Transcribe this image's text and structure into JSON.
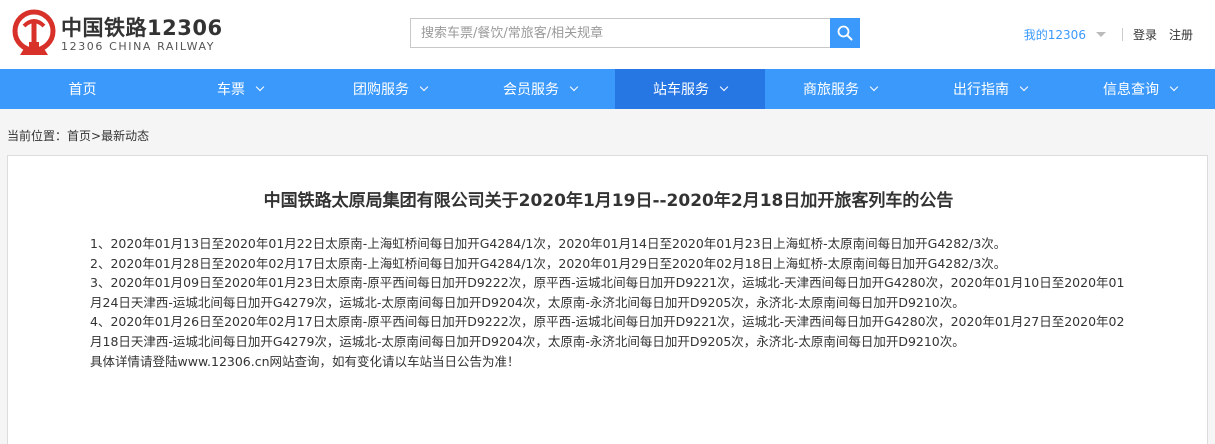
{
  "header": {
    "logo_cn": "中国铁路12306",
    "logo_en": "12306 CHINA RAILWAY",
    "search_placeholder": "搜索车票/餐饮/常旅客/相关规章",
    "my_account": "我的12306",
    "login": "登录",
    "register": "注册"
  },
  "nav": {
    "items": [
      {
        "label": "首页"
      },
      {
        "label": "车票"
      },
      {
        "label": "团购服务"
      },
      {
        "label": "会员服务"
      },
      {
        "label": "站车服务"
      },
      {
        "label": "商旅服务"
      },
      {
        "label": "出行指南"
      },
      {
        "label": "信息查询"
      }
    ],
    "active_index": 4
  },
  "breadcrumb": {
    "prefix": "当前位置：",
    "home": "首页",
    "separator": ">",
    "current": "最新动态"
  },
  "article": {
    "title": "中国铁路太原局集团有限公司关于2020年1月19日--2020年2月18日加开旅客列车的公告",
    "paragraphs": [
      "1、2020年01月13日至2020年01月22日太原南-上海虹桥间每日加开G4284/1次，2020年01月14日至2020年01月23日上海虹桥-太原南间每日加开G4282/3次。",
      "2、2020年01月28日至2020年02月17日太原南-上海虹桥间每日加开G4284/1次，2020年01月29日至2020年02月18日上海虹桥-太原南间每日加开G4282/3次。",
      "3、2020年01月09日至2020年01月23日太原南-原平西间每日加开D9222次，原平西-运城北间每日加开D9221次，运城北-天津西间每日加开G4280次，2020年01月10日至2020年01月24日天津西-运城北间每日加开G4279次，运城北-太原南间每日加开D9204次，太原南-永济北间每日加开D9205次，永济北-太原南间每日加开D9210次。",
      "4、2020年01月26日至2020年02月17日太原南-原平西间每日加开D9222次，原平西-运城北间每日加开D9221次，运城北-天津西间每日加开G4280次，2020年01月27日至2020年02月18日天津西-运城北间每日加开G4279次，运城北-太原南间每日加开D9204次，太原南-永济北间每日加开D9205次，永济北-太原南间每日加开D9210次。",
      "具体详情请登陆www.12306.cn网站查询，如有变化请以车站当日公告为准！"
    ]
  },
  "colors": {
    "brand_blue": "#3b99fc",
    "nav_active": "#2676e3",
    "logo_red": "#d7312a"
  }
}
